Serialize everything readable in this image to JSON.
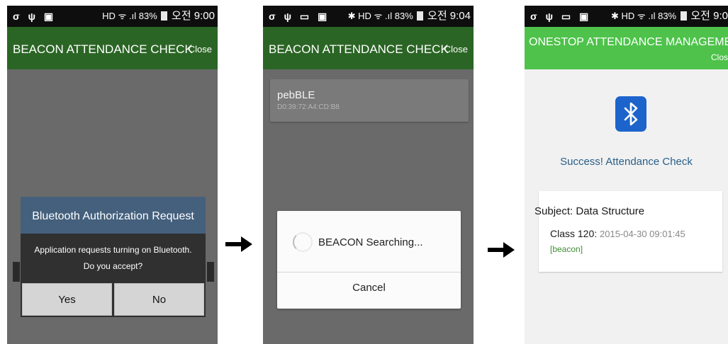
{
  "screens": [
    {
      "status": {
        "left_icons": "σ ψ ▣",
        "right_text": "HD ᯤ .ıl 83%",
        "time": "오전 9:00"
      },
      "appbar": {
        "title": "BEACON ATTENDANCE CHECK",
        "close": "Close"
      },
      "dialog": {
        "title": "Bluetooth Authorization Request",
        "message_line1": "Application requests turning on Bluetooth.",
        "message_line2": "Do you accept?",
        "yes": "Yes",
        "no": "No"
      }
    },
    {
      "status": {
        "left_icons": "σ ψ ▭ ▣",
        "right_text": "✱ HD ᯤ .ıl 83%",
        "time": "오전 9:04"
      },
      "appbar": {
        "title": "BEACON ATTENDANCE CHECK",
        "close": "Close"
      },
      "device": {
        "name": "pebBLE",
        "mac": "D0:39:72:A4:CD:B8"
      },
      "progress_dialog": {
        "message": "BEACON Searching...",
        "cancel": "Cancel"
      }
    },
    {
      "status": {
        "left_icons": "σ ψ ▭ ▣",
        "right_text": "✱ HD ᯤ .ıl 83%",
        "time": "오전 9:0"
      },
      "appbar": {
        "title": "ONESTOP ATTENDANCE MANAGEMENT",
        "close": "Clos"
      },
      "success_text": "Success! Attendance Check",
      "result": {
        "subject": "Subject: Data Structure",
        "class_label": "Class 120: ",
        "datetime": "2015-04-30 09:01:45",
        "method": "[beacon]"
      }
    }
  ],
  "icons": {
    "arrow": "right-arrow-icon",
    "bluetooth": "bluetooth-icon",
    "spinner": "spinner-icon"
  },
  "colors": {
    "dark_appbar": "#2b6525",
    "light_appbar": "#4ec24a",
    "dialog_header": "#44607d",
    "bluetooth_blue": "#1c63cc"
  }
}
